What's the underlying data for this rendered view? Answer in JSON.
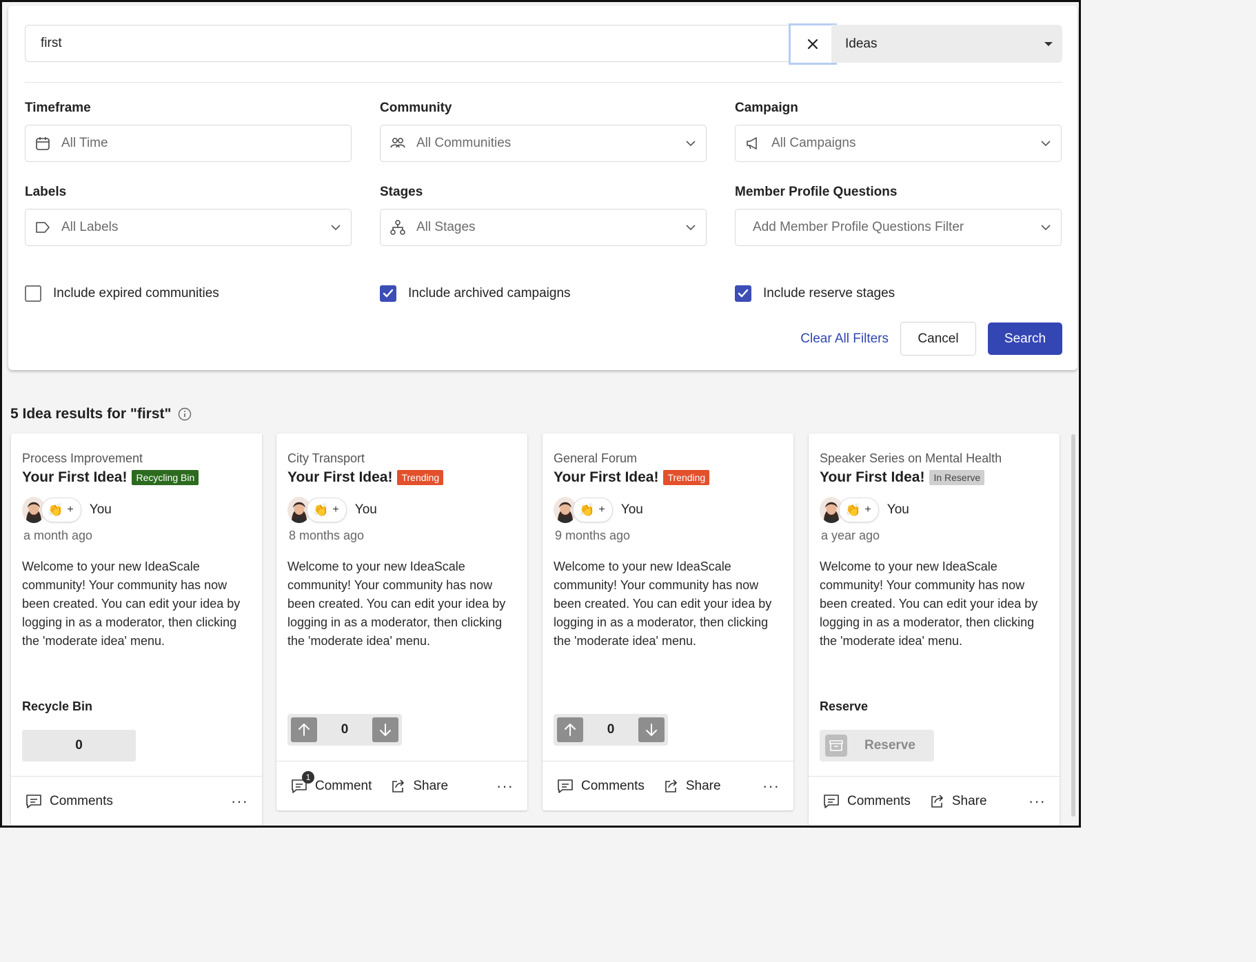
{
  "search": {
    "query": "first",
    "type_selected": "Ideas"
  },
  "filters": {
    "timeframe": {
      "label": "Timeframe",
      "value": "All Time"
    },
    "community": {
      "label": "Community",
      "value": "All Communities"
    },
    "campaign": {
      "label": "Campaign",
      "value": "All Campaigns"
    },
    "labels": {
      "label": "Labels",
      "value": "All Labels"
    },
    "stages": {
      "label": "Stages",
      "value": "All Stages"
    },
    "member_profile": {
      "label": "Member Profile Questions",
      "value": "Add Member Profile Questions Filter"
    }
  },
  "checkboxes": [
    {
      "label": "Include expired communities",
      "checked": false
    },
    {
      "label": "Include archived campaigns",
      "checked": true
    },
    {
      "label": "Include reserve stages",
      "checked": true
    }
  ],
  "actions": {
    "clear_all": "Clear All Filters",
    "cancel": "Cancel",
    "search": "Search"
  },
  "results": {
    "heading": "5 Idea results for \"first\""
  },
  "cards": [
    {
      "community": "Process Improvement",
      "title": "Your First Idea!",
      "badge": "Recycling Bin",
      "badge_color": "#2c6b1f",
      "author": "You",
      "plus": "+",
      "time": "a month ago",
      "body": "Welcome to your new IdeaScale community! Your community has now been created. You can edit your idea by logging in as a moderator, then clicking the 'moderate idea' menu.",
      "stage_title": "Recycle Bin",
      "votes": "0",
      "comment_label": "Comments",
      "more": "···"
    },
    {
      "community": "City Transport",
      "title": "Your First Idea!",
      "badge": "Trending",
      "badge_color": "#e2512c",
      "author": "You",
      "plus": "+",
      "time": "8 months ago",
      "body": "Welcome to your new IdeaScale community! Your community has now been created. You can edit your idea by logging in as a moderator, then clicking the 'moderate idea' menu.",
      "votes": "0",
      "comment_label": "Comment",
      "comment_count": "1",
      "share_label": "Share",
      "more": "···"
    },
    {
      "community": "General Forum",
      "title": "Your First Idea!",
      "badge": "Trending",
      "badge_color": "#e2512c",
      "author": "You",
      "plus": "+",
      "time": "9 months ago",
      "body": "Welcome to your new IdeaScale community! Your community has now been created. You can edit your idea by logging in as a moderator, then clicking the 'moderate idea' menu.",
      "votes": "0",
      "comment_label": "Comments",
      "share_label": "Share",
      "more": "···"
    },
    {
      "community": "Speaker Series on Mental Health",
      "title": "Your First Idea!",
      "badge": "In Reserve",
      "badge_color": "#cfcfcf",
      "author": "You",
      "plus": "+",
      "time": "a year ago",
      "body": "Welcome to your new IdeaScale community! Your community has now been created. You can edit your idea by logging in as a moderator, then clicking the 'moderate idea' menu.",
      "stage_title": "Reserve",
      "reserve_label": "Reserve",
      "comment_label": "Comments",
      "share_label": "Share",
      "more": "···"
    }
  ],
  "colors": {
    "primary": "#3446b3",
    "link": "#2f46b0",
    "checkbox": "#3c4eb6"
  }
}
